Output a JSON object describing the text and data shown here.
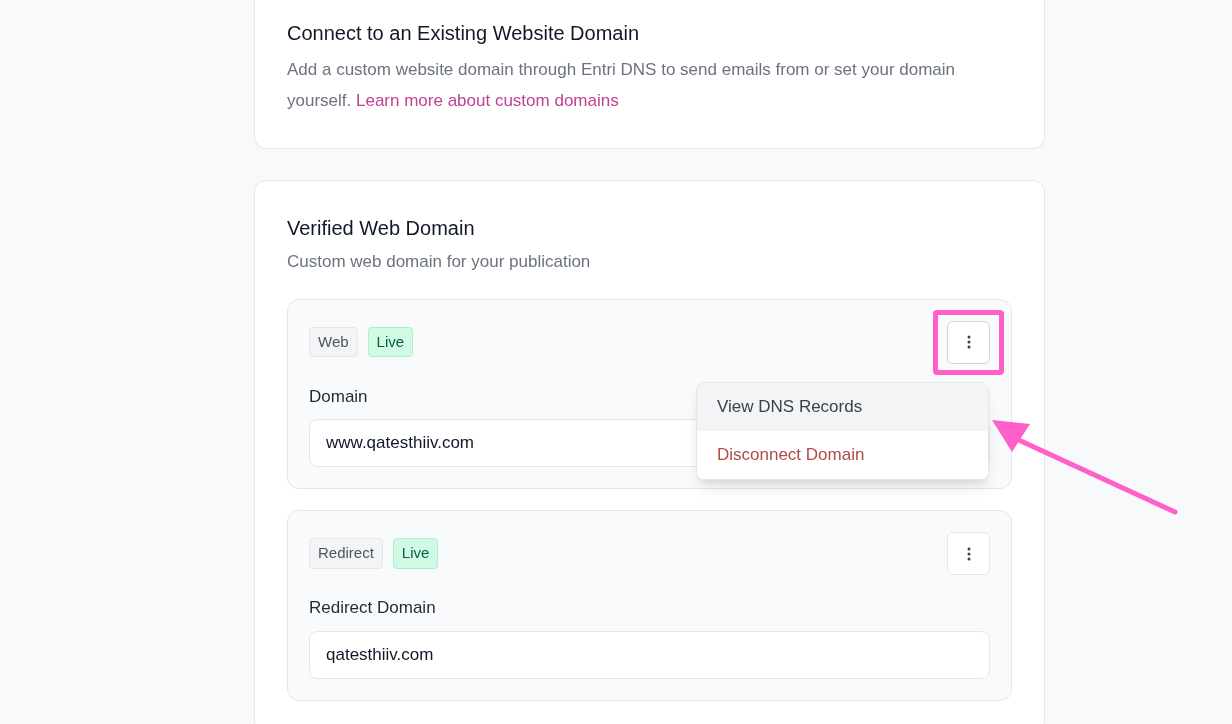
{
  "connect_card": {
    "title": "Connect to an Existing Website Domain",
    "description": "Add a custom website domain through Entri DNS to send emails from or set your domain yourself.",
    "link": "Learn more about custom domains"
  },
  "verified_card": {
    "title": "Verified Web Domain",
    "subtitle": "Custom web domain for your publication",
    "domains": [
      {
        "type": "Web",
        "status": "Live",
        "label": "Domain",
        "value": "www.qatesthiiv.com",
        "menu_open": true,
        "annotated": true,
        "menu": [
          {
            "label": "View DNS Records",
            "kind": "normal",
            "highlighted": true
          },
          {
            "label": "Disconnect Domain",
            "kind": "danger",
            "highlighted": false
          }
        ]
      },
      {
        "type": "Redirect",
        "status": "Live",
        "label": "Redirect Domain",
        "value": "qatesthiiv.com",
        "menu_open": false,
        "annotated": false
      }
    ]
  }
}
